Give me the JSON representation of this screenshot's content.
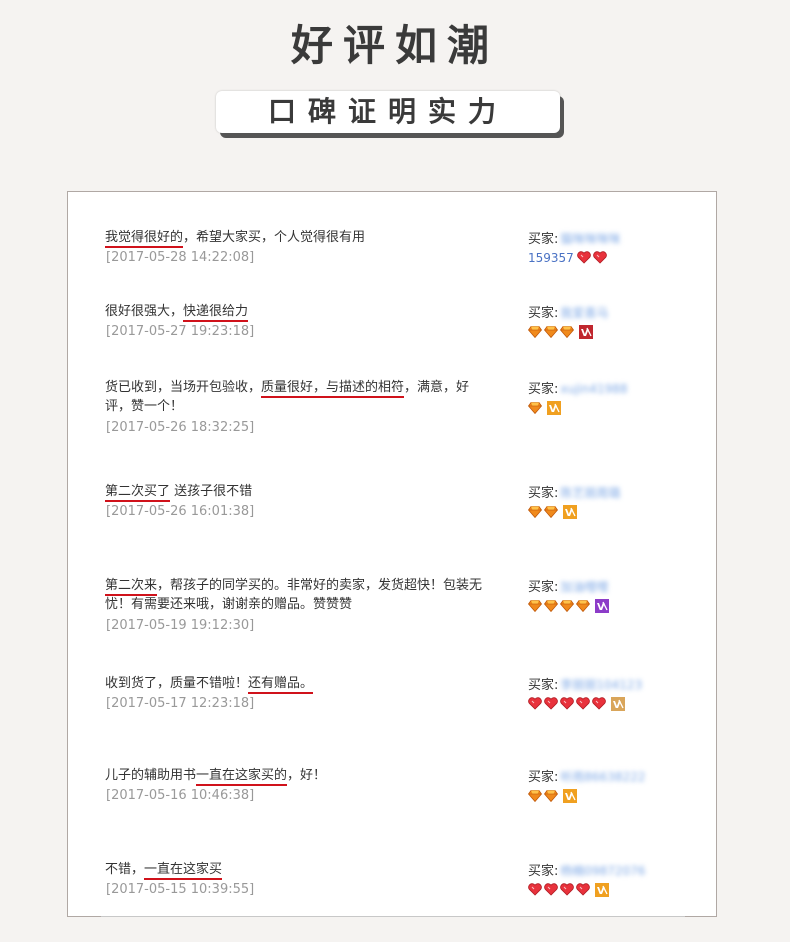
{
  "header": {
    "title": "好评如潮",
    "subtitle": "口碑证明实力"
  },
  "buyer_label": "买家:",
  "reviews": [
    {
      "parts": [
        {
          "t": "我觉得很好的",
          "hl": true
        },
        {
          "t": "，希望大家买，个人觉得很有用",
          "hl": false
        }
      ],
      "date": "[2017-05-28 14:22:08]",
      "buyer_name": "猫咪咪咪咪",
      "buyer_id": "159357",
      "badges": [
        "heart",
        "heart"
      ],
      "vip": ""
    },
    {
      "parts": [
        {
          "t": "很好很强大，",
          "hl": false
        },
        {
          "t": "快递很给力",
          "hl": true
        }
      ],
      "date": "[2017-05-27 19:23:18]",
      "buyer_name": "我爱喜马",
      "buyer_id": "",
      "badges": [
        "diamond",
        "diamond",
        "diamond"
      ],
      "vip": "red"
    },
    {
      "parts": [
        {
          "t": "货已收到，当场开包验收，",
          "hl": false
        },
        {
          "t": "质量很好，与描述的相符",
          "hl": true
        },
        {
          "t": "，满意，好评，赞一个！",
          "hl": false
        }
      ],
      "date": "[2017-05-26 18:32:25]",
      "buyer_name": "xujin41988",
      "buyer_id": "",
      "badges": [
        "diamond"
      ],
      "vip": "orange"
    },
    {
      "parts": [
        {
          "t": "第二次买了",
          "hl": true
        },
        {
          "t": " 送孩子很不错",
          "hl": false
        }
      ],
      "date": "[2017-05-26 16:01:38]",
      "buyer_name": "陈艺丽周璐",
      "buyer_id": "",
      "badges": [
        "diamond",
        "diamond"
      ],
      "vip": "orange"
    },
    {
      "parts": [
        {
          "t": "第二次来",
          "hl": true
        },
        {
          "t": "，帮孩子的同学买的。非常好的卖家，发货超快！包装无忧！有需要还来哦，谢谢亲的赠品。赞赞赞",
          "hl": false
        }
      ],
      "date": "[2017-05-19 19:12:30]",
      "buyer_name": "加油哩哩",
      "buyer_id": "",
      "badges": [
        "diamond",
        "diamond",
        "diamond",
        "diamond"
      ],
      "vip": "purple"
    },
    {
      "parts": [
        {
          "t": "收到货了，质量不错啦！",
          "hl": false
        },
        {
          "t": "还有赠品。",
          "hl": true
        }
      ],
      "date": "[2017-05-17 12:23:18]",
      "buyer_name": "李丽丽104123",
      "buyer_id": "",
      "badges": [
        "heart",
        "heart",
        "heart",
        "heart",
        "heart"
      ],
      "vip": "tan"
    },
    {
      "parts": [
        {
          "t": "儿子的辅助用书",
          "hl": false
        },
        {
          "t": "一直在这家买的",
          "hl": true
        },
        {
          "t": "，好！",
          "hl": false
        }
      ],
      "date": "[2017-05-16 10:46:38]",
      "buyer_name": "听雨86638222",
      "buyer_id": "",
      "badges": [
        "diamond",
        "diamond"
      ],
      "vip": "orange"
    },
    {
      "parts": [
        {
          "t": "不错，",
          "hl": false
        },
        {
          "t": "一直在这家买",
          "hl": true
        }
      ],
      "date": "[2017-05-15 10:39:55]",
      "buyer_name": "杨楠09872076",
      "buyer_id": "",
      "badges": [
        "heart",
        "heart",
        "heart",
        "heart"
      ],
      "vip": "orange"
    }
  ],
  "colors": {
    "highlight_underline": "#d0121b",
    "date": "#999999",
    "buyer_name": "#7fa9e6"
  },
  "icons": [
    "heart-badge-icon",
    "diamond-badge-icon",
    "vip-badge-icon"
  ]
}
